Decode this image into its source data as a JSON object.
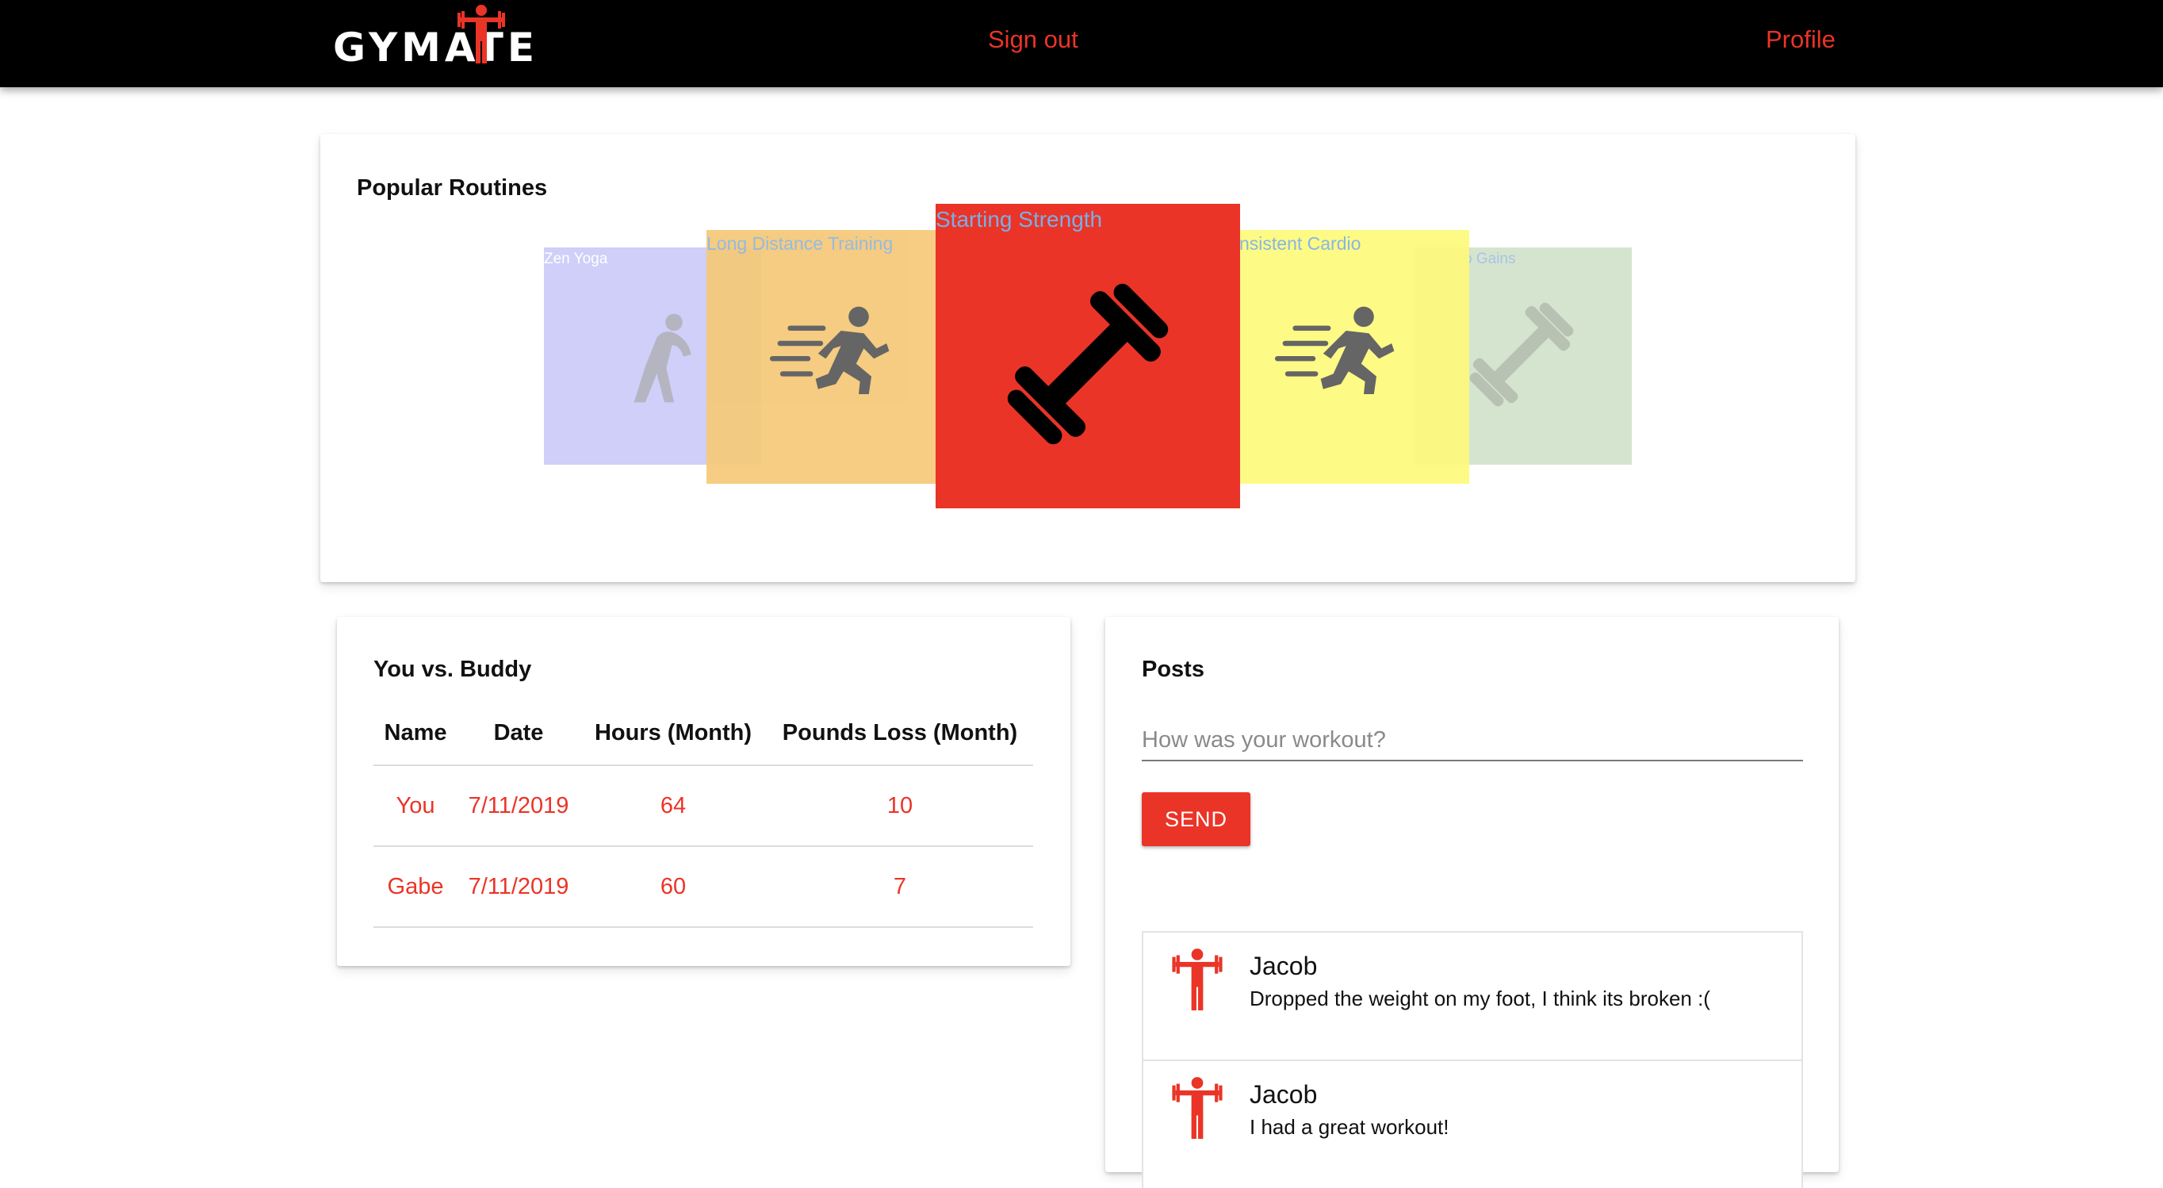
{
  "brand": {
    "logo_text": "GYMATE",
    "accent_color": "#ea3427"
  },
  "nav": {
    "signout_label": "Sign out",
    "profile_label": "Profile"
  },
  "routines": {
    "title": "Popular Routines",
    "slides": [
      {
        "label": "Zen Yoga",
        "color": "#cfcff9",
        "icon": "yoga-stretch-icon"
      },
      {
        "label": "Long Distance Training",
        "color": "#f5c978",
        "icon": "running-icon"
      },
      {
        "label": "Starting Strength",
        "color": "#ea3427",
        "icon": "dumbbell-icon"
      },
      {
        "label": "nsistent Cardio",
        "color": "#fdfa7d",
        "icon": "running-icon"
      },
      {
        "label": "o Gains",
        "color": "#d5e4cf",
        "icon": "dumbbell-icon"
      }
    ]
  },
  "buddy": {
    "title": "You vs. Buddy",
    "columns": [
      "Name",
      "Date",
      "Hours (Month)",
      "Pounds Loss (Month)"
    ],
    "rows": [
      [
        "You",
        "7/11/2019",
        "64",
        "10"
      ],
      [
        "Gabe",
        "7/11/2019",
        "60",
        "7"
      ]
    ]
  },
  "posts": {
    "title": "Posts",
    "input_placeholder": "How was your workout?",
    "send_label": "SEND",
    "items": [
      {
        "author": "Jacob",
        "text": "Dropped the weight on my foot, I think its broken :(",
        "avatar": "weightlifter-icon"
      },
      {
        "author": "Jacob",
        "text": "I had a great workout!",
        "avatar": "weightlifter-icon"
      }
    ]
  }
}
